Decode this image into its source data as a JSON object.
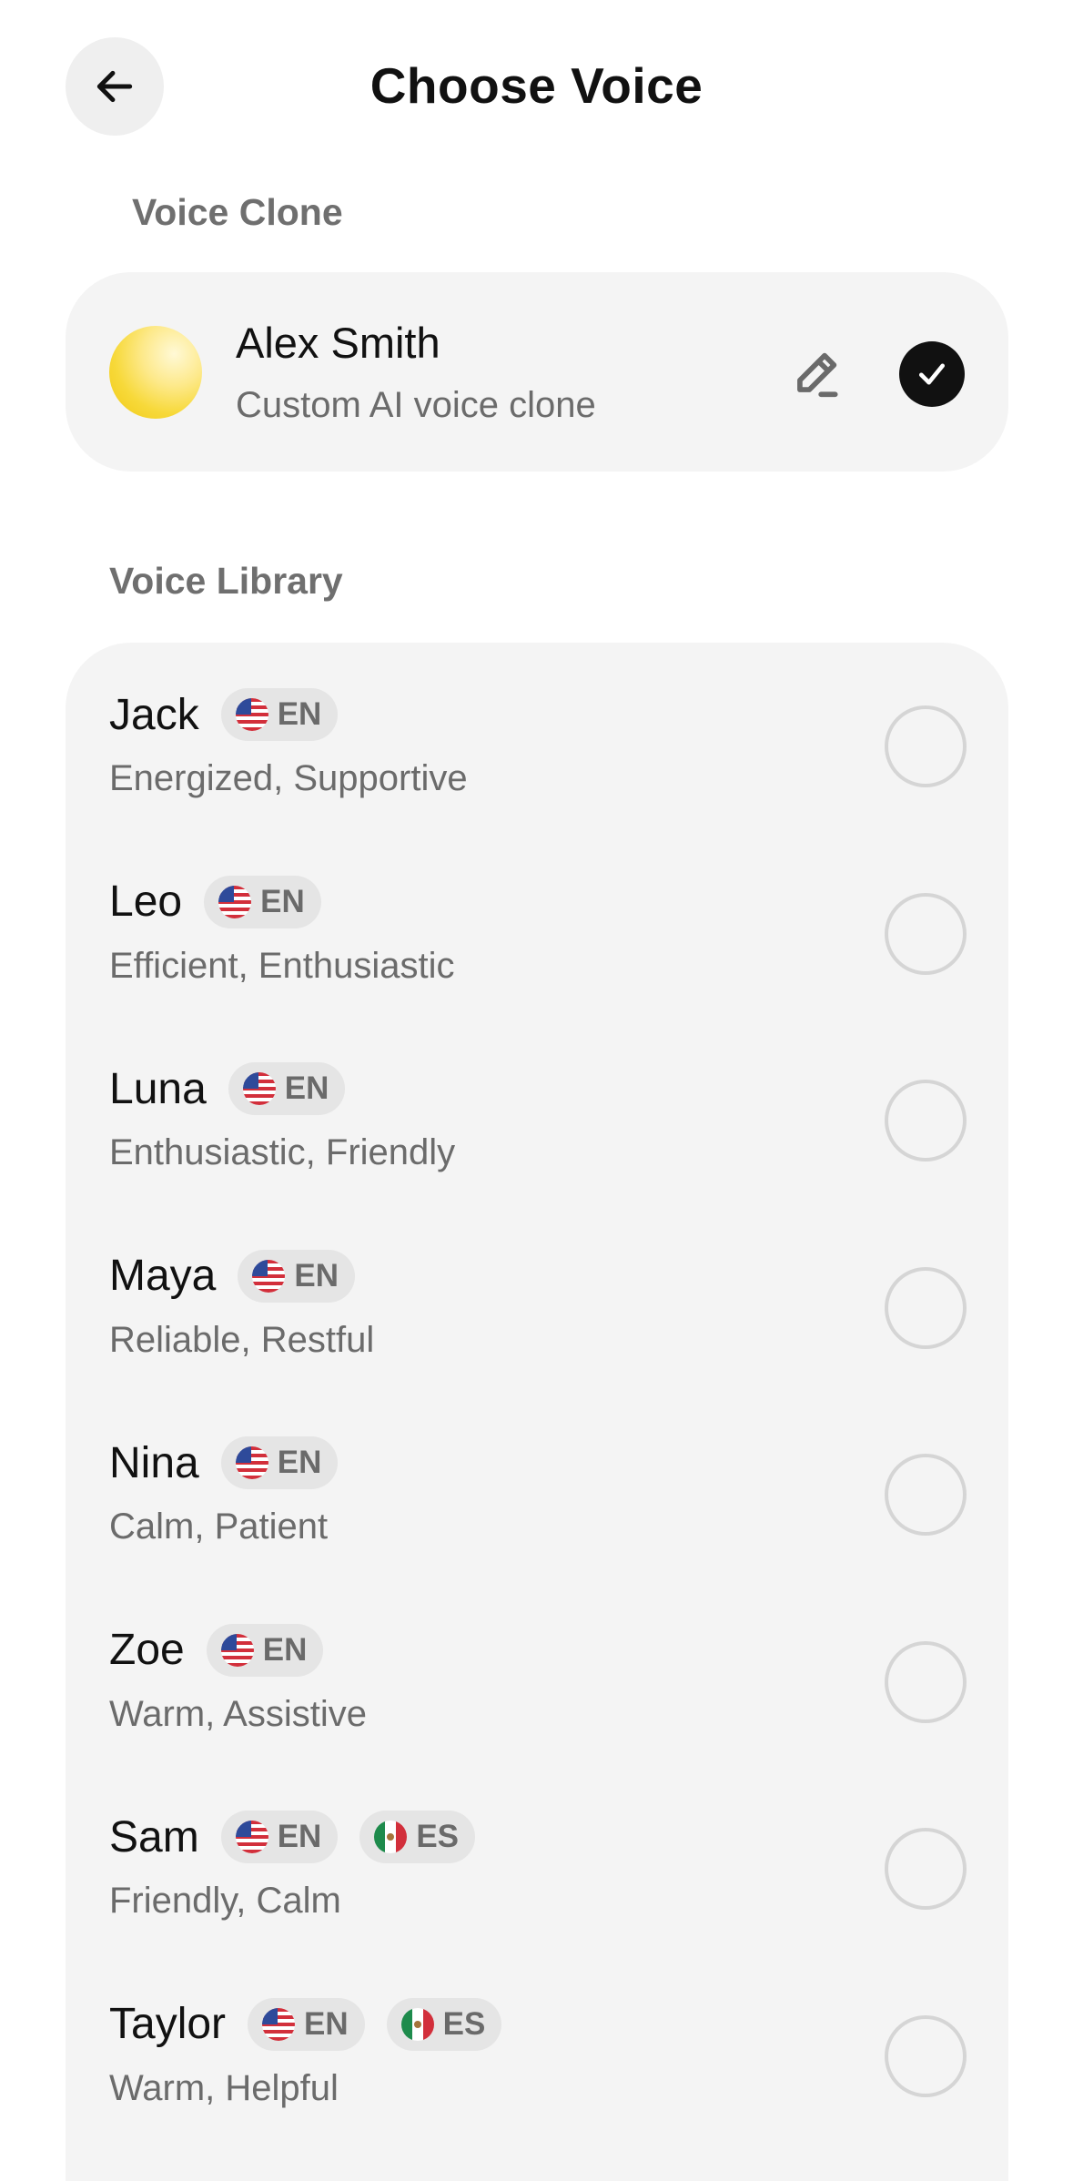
{
  "header": {
    "title": "Choose Voice",
    "back_icon": "arrow-left-icon"
  },
  "voice_clone": {
    "section_label": "Voice Clone",
    "name": "Alex Smith",
    "subtitle": "Custom AI voice clone",
    "edit_icon": "pencil-icon",
    "selected": true,
    "check_icon": "check-icon"
  },
  "voice_library": {
    "section_label": "Voice Library",
    "voices": [
      {
        "name": "Jack",
        "traits": "Energized, Supportive",
        "languages": [
          "EN"
        ],
        "selected": false
      },
      {
        "name": "Leo",
        "traits": "Efficient, Enthusiastic",
        "languages": [
          "EN"
        ],
        "selected": false
      },
      {
        "name": "Luna",
        "traits": "Enthusiastic, Friendly",
        "languages": [
          "EN"
        ],
        "selected": false
      },
      {
        "name": "Maya",
        "traits": "Reliable, Restful",
        "languages": [
          "EN"
        ],
        "selected": false
      },
      {
        "name": "Nina",
        "traits": "Calm, Patient",
        "languages": [
          "EN"
        ],
        "selected": false
      },
      {
        "name": "Zoe",
        "traits": "Warm, Assistive",
        "languages": [
          "EN"
        ],
        "selected": false
      },
      {
        "name": "Sam",
        "traits": "Friendly, Calm",
        "languages": [
          "EN",
          "ES"
        ],
        "selected": false
      },
      {
        "name": "Taylor",
        "traits": "Warm, Helpful",
        "languages": [
          "EN",
          "ES"
        ],
        "selected": false
      }
    ]
  },
  "colors": {
    "accent": "#111111",
    "card_background": "#f4f4f4",
    "badge_background": "#e5e5e5",
    "muted_text": "#6b6b6b",
    "avatar_yellow": "#f7d93a"
  }
}
